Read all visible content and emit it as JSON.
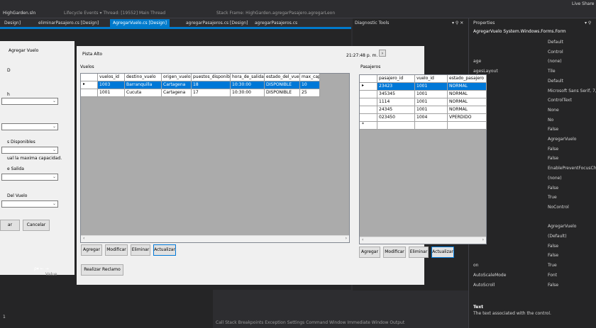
{
  "vs": {
    "toolbar_text": "Lifecycle Events ▾  Thread: [19552] Main Thread",
    "stack_frame": "Stack Frame: HighGarden.agregarPasajero.agregarLeon",
    "live_share": "Live Share",
    "file_tab": "HighGarden.sln",
    "tabs": [
      "Design]",
      "eliminarPasajero.cs [Design]",
      "AgregarVuelo.cs [Design]",
      "agregarPasajeros.cs [Design]",
      "agregarPasajeros.cs"
    ],
    "diag_title": "Diagnostic Tools",
    "props_title": "Properties",
    "props_object": "AgregarVuelo  System.Windows.Forms.Form",
    "bottom_tabs": "Call Stack   Breakpoints   Exception Settings   Command Window   Immediate Window   Output",
    "value_label": "Value",
    "left_status": "1"
  },
  "leftform": {
    "labels": [
      "Agregar Vuelo",
      "D",
      "h",
      "s Disponibles",
      "ual la maxima capacidad.",
      "e Salida",
      "Del Vuelo"
    ],
    "buttons": [
      "ar",
      "Cancelar"
    ]
  },
  "form": {
    "title": "Pista Alto",
    "time": "21:27:48 p. m.",
    "vuelos_label": "Vuelos",
    "pasajeros_label": "Pasajeros",
    "vuelos_headers": [
      "vuelos_id",
      "destino_vuelo",
      "origen_vuelo",
      "puestos_disponible",
      "hora_de_salida",
      "estado_del_vuelo",
      "max_capaci"
    ],
    "vuelos_rows": [
      [
        "1003",
        "Barranquilla",
        "Cartagena",
        "18",
        "10:30:00",
        "DISPONIBLE",
        "10"
      ],
      [
        "1001",
        "Cucuta",
        "Cartagena",
        "17",
        "10:30:00",
        "DISPONIBLE",
        "25"
      ]
    ],
    "pasajeros_headers": [
      "pasajero_id",
      "vuelo_id",
      "estado_pasajero"
    ],
    "pasajeros_rows": [
      [
        "23423",
        "1001",
        "NORMAL"
      ],
      [
        "345345",
        "1001",
        "NORMAL"
      ],
      [
        "1114",
        "1001",
        "NORMAL"
      ],
      [
        "24345",
        "1001",
        "NORMAL"
      ],
      [
        "023450",
        "1004",
        "VPERDIDO"
      ]
    ],
    "btn_agregar": "Agregar",
    "btn_modificar": "Modificar",
    "btn_eliminar": "Eliminar",
    "btn_actualizar": "Actualizar",
    "btn_reclamo": "Realizar Reclamo"
  },
  "props": {
    "rows": [
      [
        "",
        "Default"
      ],
      [
        "",
        "Control"
      ],
      [
        "age",
        "(none)"
      ],
      [
        "agesLayout",
        "Tile"
      ],
      [
        "",
        "Default"
      ],
      [
        "",
        "Microsoft Sans Serif, 7,8pt"
      ],
      [
        "",
        "ControlText"
      ],
      [
        "le",
        "None"
      ],
      [
        "",
        "No"
      ],
      [
        "out",
        "False"
      ],
      [
        "",
        "AgregarVuelo"
      ],
      [
        "",
        "False"
      ],
      [
        "",
        "False"
      ],
      [
        "",
        "EnablePreventFocusChange"
      ],
      [
        "trip",
        "(none)"
      ],
      [
        "d",
        "False"
      ],
      [
        "",
        "True"
      ],
      [
        "",
        "NoControl"
      ],
      [
        "ttings)",
        ""
      ],
      [
        "",
        "AgregarVuelo"
      ],
      [
        "",
        "(Default)"
      ],
      [
        "",
        "False"
      ],
      [
        "",
        "False"
      ],
      [
        "on",
        "True"
      ],
      [
        "AutoScaleMode",
        "Font"
      ],
      [
        "AutoScroll",
        "False"
      ]
    ],
    "desc_title": "Text",
    "desc_text": "The text associated with the control."
  }
}
